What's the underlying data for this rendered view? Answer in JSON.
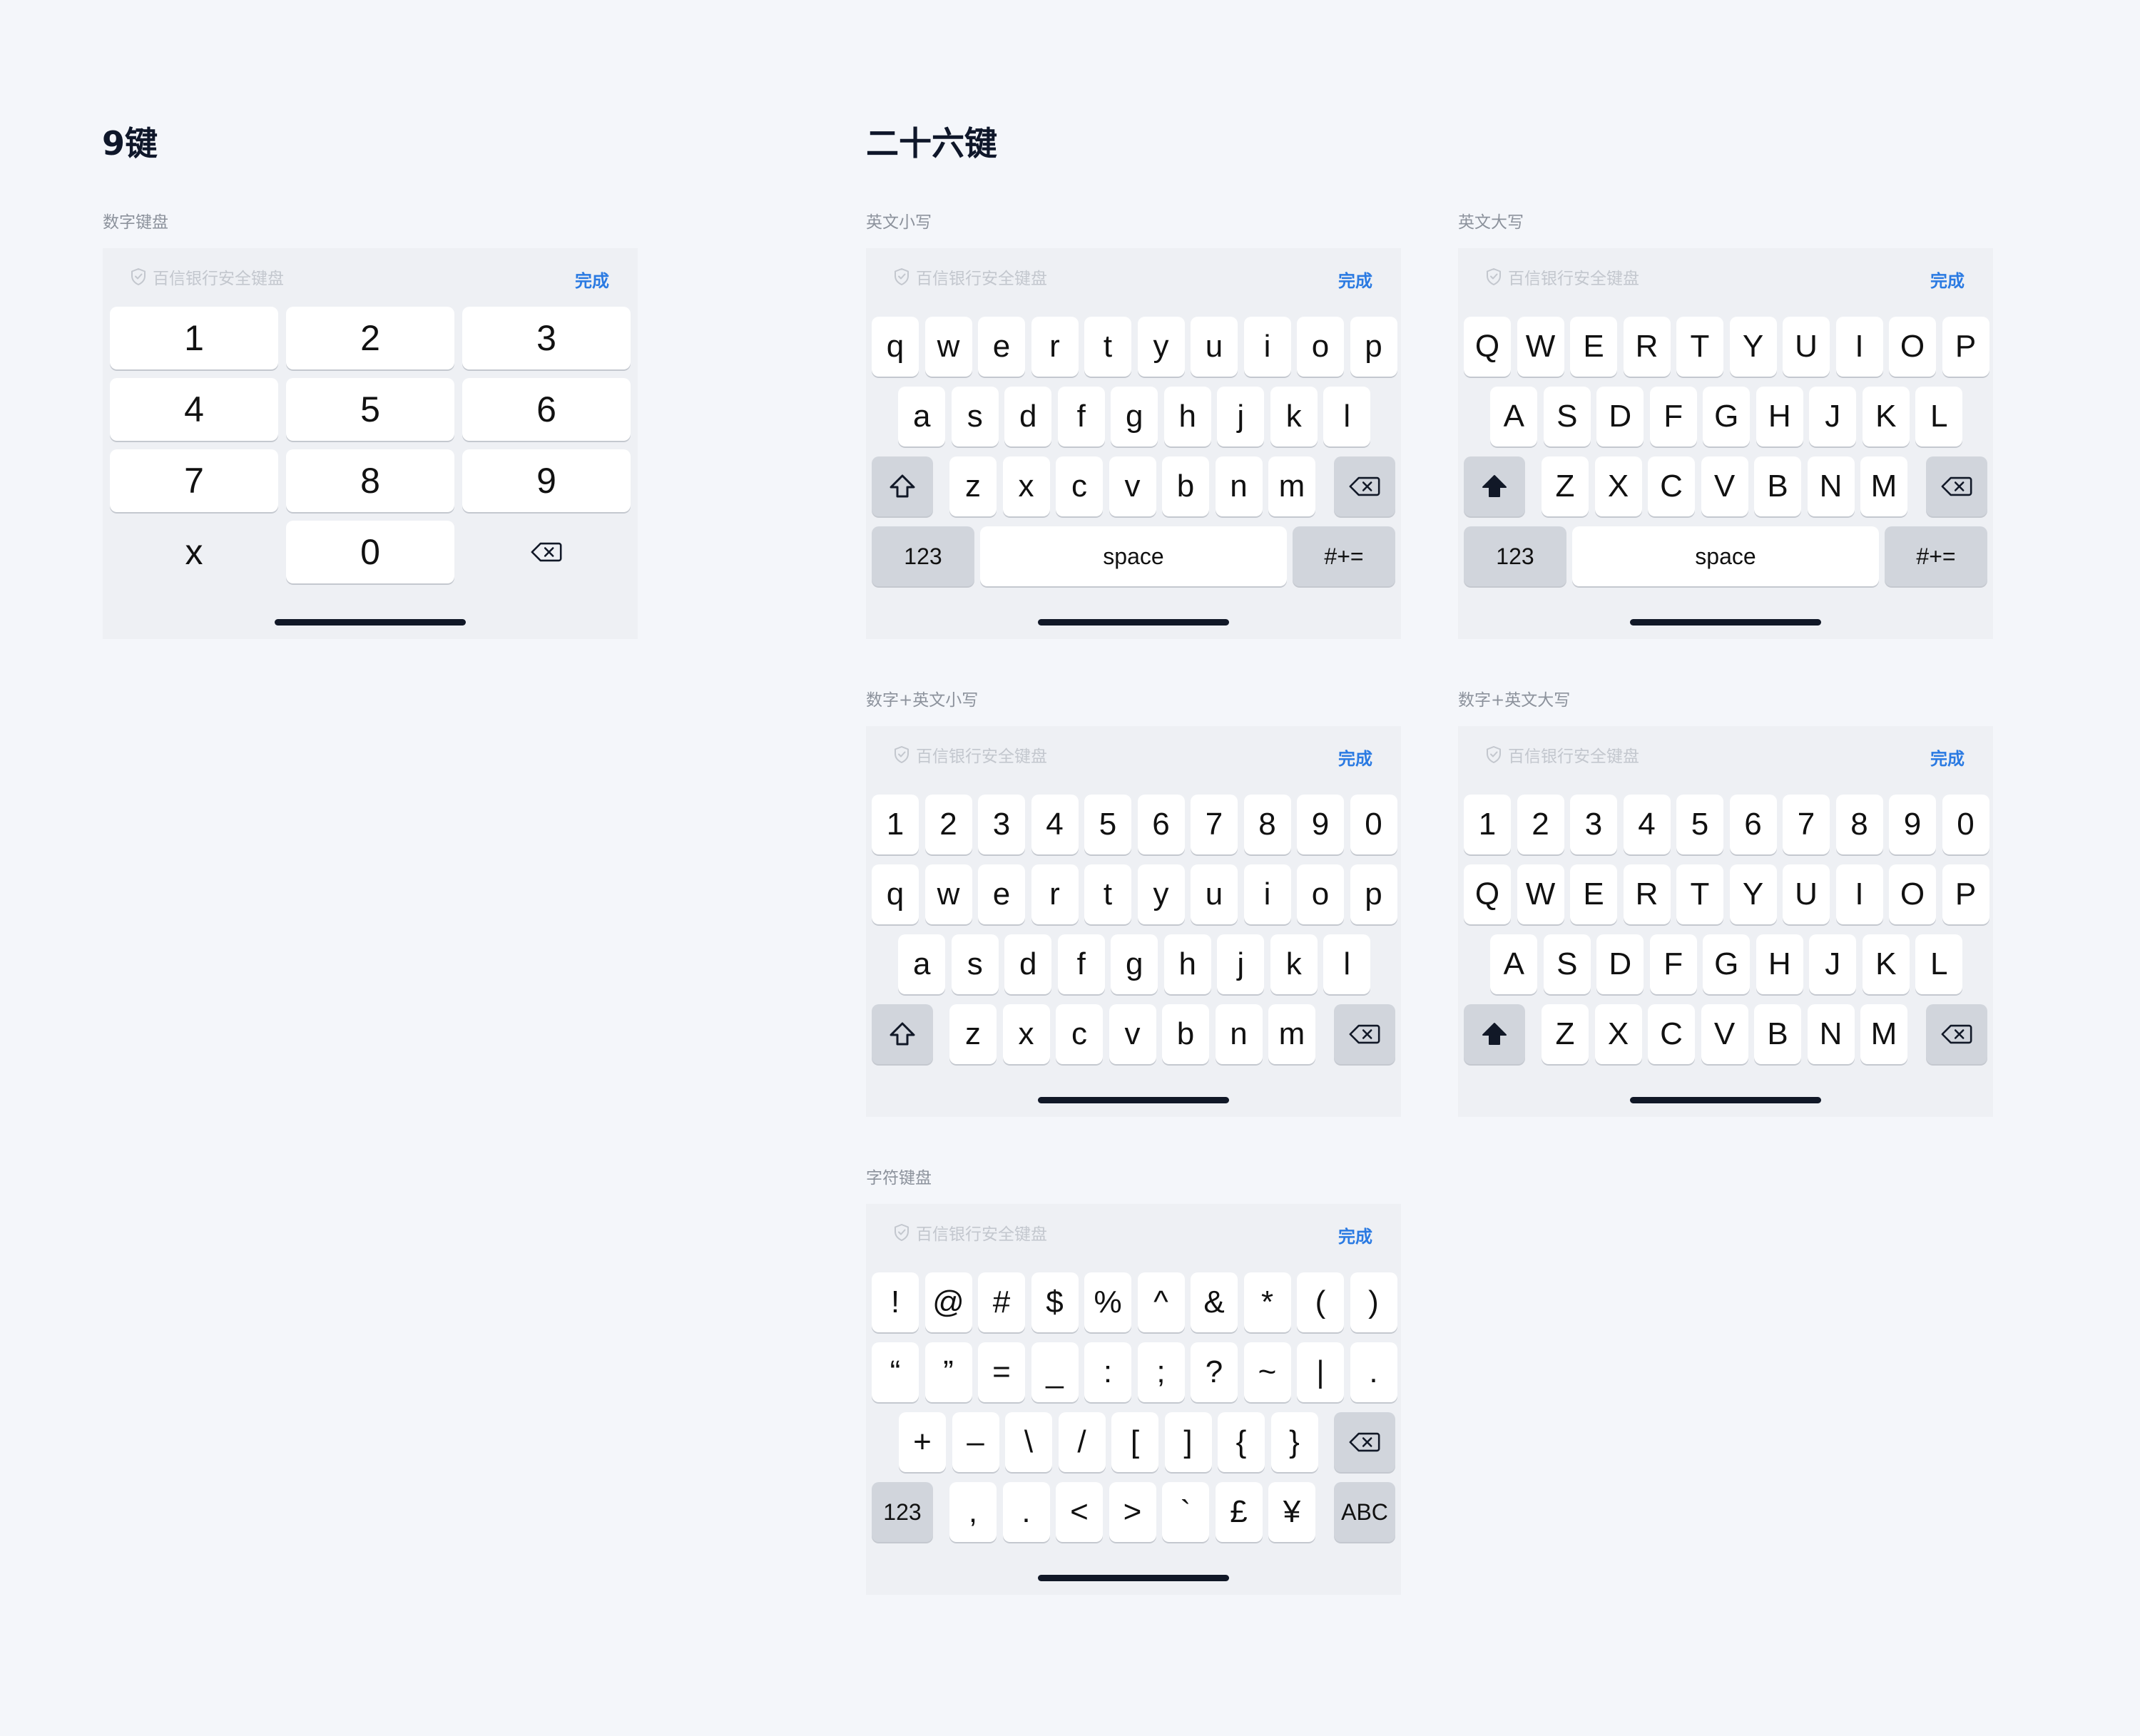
{
  "sections": {
    "nine_key": "9键",
    "twenty_six_key": "二十六键"
  },
  "keyboard_header": {
    "brand": "百信银行安全键盘",
    "done": "完成",
    "brand_icon": "shield-check-icon"
  },
  "keyboards": {
    "numeric": {
      "label": "数字键盘",
      "rows": [
        [
          "1",
          "2",
          "3"
        ],
        [
          "4",
          "5",
          "6"
        ],
        [
          "7",
          "8",
          "9"
        ],
        [
          "x",
          "0",
          "delete"
        ]
      ]
    },
    "lower": {
      "label": "英文小写",
      "rows": [
        [
          "q",
          "w",
          "e",
          "r",
          "t",
          "y",
          "u",
          "i",
          "o",
          "p"
        ],
        [
          "a",
          "s",
          "d",
          "f",
          "g",
          "h",
          "j",
          "k",
          "l"
        ],
        [
          "shift",
          "z",
          "x",
          "c",
          "v",
          "b",
          "n",
          "m",
          "delete"
        ],
        [
          "123",
          "space",
          "#+="
        ]
      ]
    },
    "upper": {
      "label": "英文大写",
      "rows": [
        [
          "Q",
          "W",
          "E",
          "R",
          "T",
          "Y",
          "U",
          "I",
          "O",
          "P"
        ],
        [
          "A",
          "S",
          "D",
          "F",
          "G",
          "H",
          "J",
          "K",
          "L"
        ],
        [
          "shift",
          "Z",
          "X",
          "C",
          "V",
          "B",
          "N",
          "M",
          "delete"
        ],
        [
          "123",
          "space",
          "#+="
        ]
      ]
    },
    "num_lower": {
      "label": "数字+英文小写",
      "rows": [
        [
          "1",
          "2",
          "3",
          "4",
          "5",
          "6",
          "7",
          "8",
          "9",
          "0"
        ],
        [
          "q",
          "w",
          "e",
          "r",
          "t",
          "y",
          "u",
          "i",
          "o",
          "p"
        ],
        [
          "a",
          "s",
          "d",
          "f",
          "g",
          "h",
          "j",
          "k",
          "l"
        ],
        [
          "shift",
          "z",
          "x",
          "c",
          "v",
          "b",
          "n",
          "m",
          "delete"
        ]
      ]
    },
    "num_upper": {
      "label": "数字+英文大写",
      "rows": [
        [
          "1",
          "2",
          "3",
          "4",
          "5",
          "6",
          "7",
          "8",
          "9",
          "0"
        ],
        [
          "Q",
          "W",
          "E",
          "R",
          "T",
          "Y",
          "U",
          "I",
          "O",
          "P"
        ],
        [
          "A",
          "S",
          "D",
          "F",
          "G",
          "H",
          "J",
          "K",
          "L"
        ],
        [
          "shift",
          "Z",
          "X",
          "C",
          "V",
          "B",
          "N",
          "M",
          "delete"
        ]
      ]
    },
    "symbols": {
      "label": "字符键盘",
      "rows": [
        [
          "!",
          "@",
          "#",
          "$",
          "%",
          "^",
          "&",
          "*",
          "(",
          ")"
        ],
        [
          "“",
          "”",
          "=",
          "_",
          ":",
          ";",
          "?",
          "~",
          "|",
          "."
        ],
        [
          "+",
          "–",
          "\\",
          "/",
          "[",
          "]",
          "{",
          "}",
          "delete"
        ],
        [
          "123",
          ",",
          ".",
          "<",
          ">",
          "`",
          "£",
          "¥",
          "ABC"
        ]
      ]
    }
  },
  "icons": {
    "shift": "shift-arrow-icon",
    "delete": "backspace-icon"
  },
  "colors": {
    "page_background": "#f4f6fa",
    "keyboard_background": "#eef0f4",
    "key": "#ffffff",
    "function_key": "#d1d5dc",
    "accent_done": "#2a7ae2",
    "muted_brand": "#c3c7ce"
  }
}
